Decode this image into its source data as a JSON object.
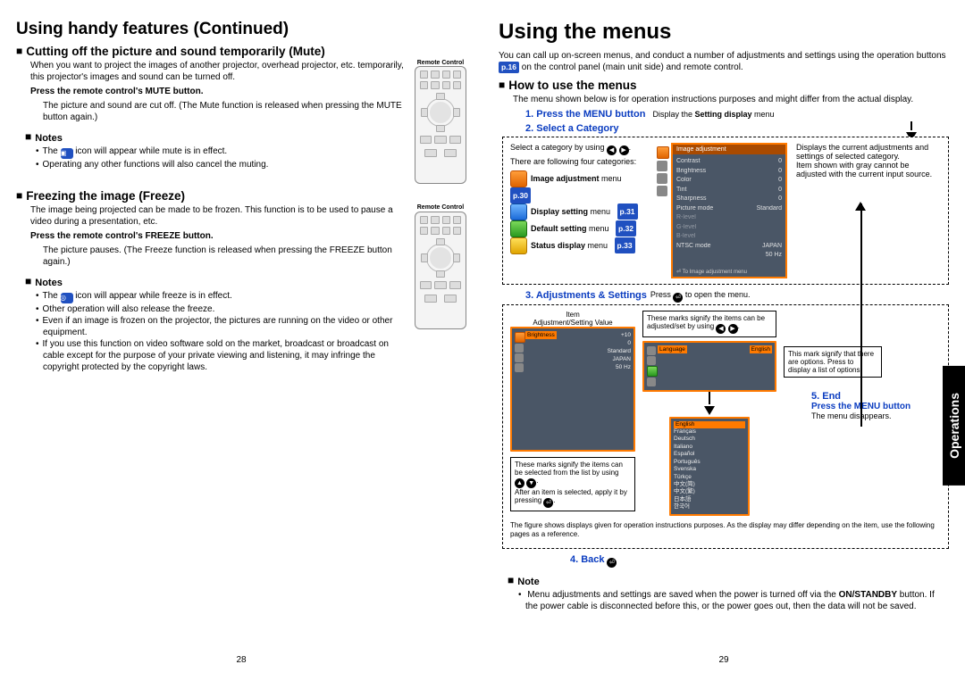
{
  "left": {
    "section_title": "Using handy features (Continued)",
    "mute": {
      "heading": "Cutting off the picture and sound temporarily (Mute)",
      "desc": "When you want to project the images of another projector, overhead projector, etc. temporarily, this projector's images and sound can be turned off.",
      "step": "Press the remote control's MUTE button.",
      "step_detail": "The picture and sound are cut off. (The Mute function is released when pressing the MUTE button again.)",
      "remote_label": "Remote Control",
      "notes_label": "Notes",
      "note1a": "The ",
      "note1b": " icon will appear while mute is in effect.",
      "note2": "Operating any other functions will also cancel the muting."
    },
    "freeze": {
      "heading": "Freezing the image (Freeze)",
      "desc": "The image being projected can be made to be frozen. This function is to be used to pause a video during a presentation, etc.",
      "step": "Press the remote control's FREEZE button.",
      "step_detail": "The picture pauses. (The Freeze function is released when pressing the FREEZE button again.)",
      "remote_label": "Remote Control",
      "notes_label": "Notes",
      "note1a": "The ",
      "note1b": " icon will appear while freeze is in effect.",
      "note2": "Other operation will also release the freeze.",
      "note3": "Even if an image is frozen on the projector, the pictures are running on the video or other equipment.",
      "note4": "If you use this function on video software sold on the market, broadcast or broadcast on cable except for the purpose of your private viewing and listening, it may infringe the copyright protected by the copyright laws."
    },
    "page_no": "28"
  },
  "right": {
    "title": "Using the menus",
    "intro_a": "You can call up on-screen menus, and conduct a number of adjustments and settings using the operation buttons ",
    "intro_b": " on the control panel (main unit side) and remote control.",
    "pref_intro": "p.16",
    "how_heading": "How to use the menus",
    "how_desc": "The menu shown below is for operation instructions purposes and might differ from the actual display.",
    "step1": "1. Press the MENU button",
    "step1_side": "Display the ",
    "step1_side_bold": "Setting display",
    "step1_side_end": " menu",
    "step2": "2. Select a Category",
    "step2_text1": "Select a category by using ",
    "step2_text2": "There are following four categories:",
    "cats": [
      {
        "label": "Image adjustment",
        "suffix": " menu",
        "pref": "p.30"
      },
      {
        "label": "Display setting",
        "suffix": " menu",
        "pref": "p.31"
      },
      {
        "label": "Default setting",
        "suffix": " menu",
        "pref": "p.32"
      },
      {
        "label": "Status display",
        "suffix": " menu",
        "pref": "p.33"
      }
    ],
    "menu_ss": {
      "head": "Image adjustment",
      "rows": [
        [
          "Contrast",
          "0"
        ],
        [
          "Brightness",
          "0"
        ],
        [
          "Color",
          "0"
        ],
        [
          "Tint",
          "0"
        ],
        [
          "Sharpness",
          "0"
        ],
        [
          "Picture mode",
          "Standard"
        ],
        [
          "R-level",
          ""
        ],
        [
          "G-level",
          ""
        ],
        [
          "B-level",
          ""
        ],
        [
          "NTSC mode",
          "JAPAN"
        ],
        [
          "",
          "50 Hz"
        ]
      ],
      "footer": "⏎  To Image adjustment menu"
    },
    "cat_side": "Displays the current adjustments and settings of selected category.\nItem shown with gray cannot be adjusted with the current input source.",
    "step3": "3. Adjustments & Settings",
    "step3_side": "Press ",
    "step3_side_end": " to open the menu.",
    "step3_item": "Item",
    "step3_val": "Adjustment/Setting Value",
    "step3_marks_lr": "These marks signify the items can be adjusted/set by using ",
    "step3_marks_ud_a": "These marks signify the items can be selected from the list by using ",
    "step3_marks_ud_b": "After an item is selected, apply it by pressing ",
    "step3_opt_box": "This mark signify that there are options. Press      to display a list of options.",
    "step3_foot": "The figure shows displays given for operation instructions purposes.  As the display may differ depending on the item, use the following pages as a reference.",
    "panelA": {
      "rows": [
        "Brightness",
        "",
        "",
        "+10",
        "0",
        "Standard",
        "",
        "",
        "",
        "JAPAN",
        "50 Hz"
      ]
    },
    "panelB": {
      "label": "Language",
      "value": "English"
    },
    "panelC_items": [
      "English",
      "Français",
      "Deutsch",
      "Italiano",
      "Español",
      "Português",
      "Svenska",
      "Türkçe",
      "中文(简)",
      "中文(繁)",
      "日本語",
      "한국어"
    ],
    "step4": "4. Back",
    "step5": "5. End",
    "step5_sub": "Press the MENU button",
    "step5_text": "The menu disappears.",
    "note_label": "Note",
    "final_note": "Menu adjustments and settings are saved when the power is turned off via the ON/STANDBY button. If the power cable is disconnected before this, or the power goes out, then the data will not be saved.",
    "page_no": "29",
    "side_tab": "Operations"
  }
}
